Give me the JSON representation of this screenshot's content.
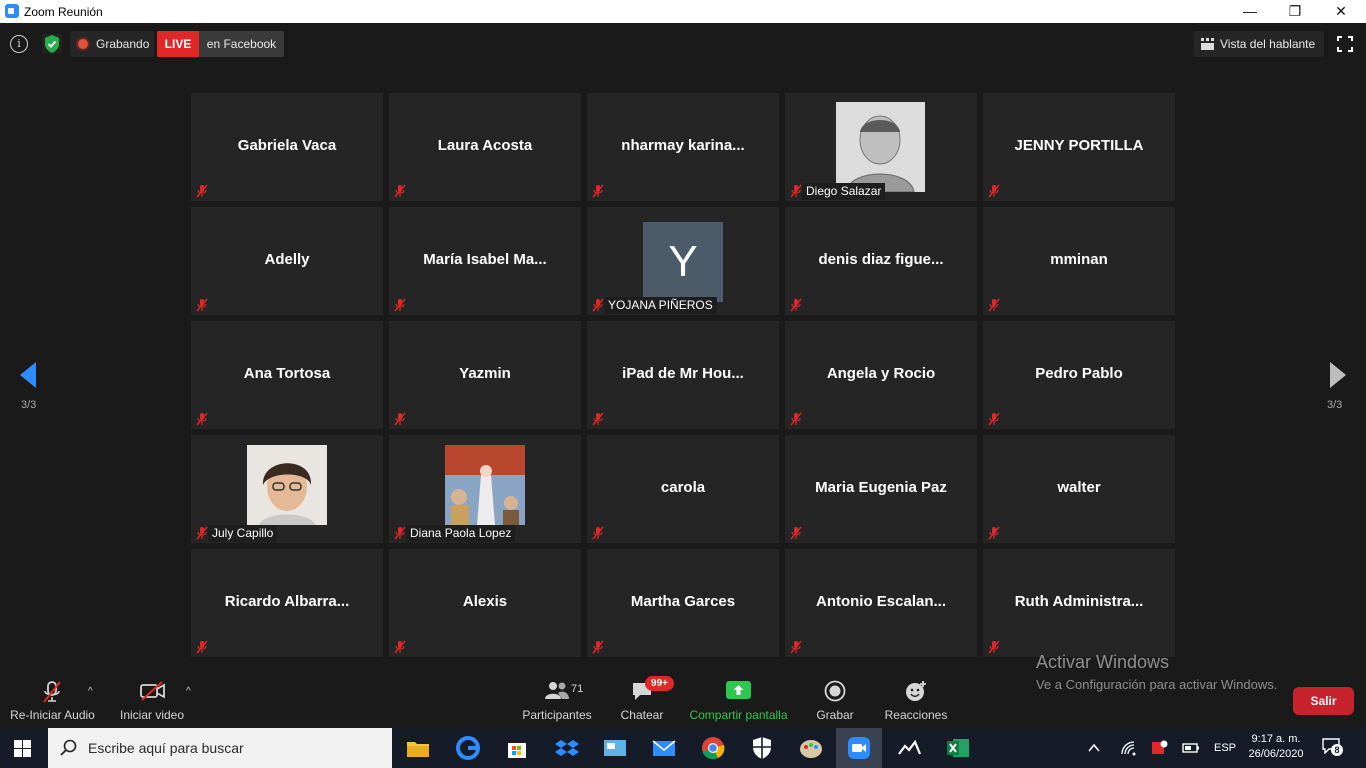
{
  "window": {
    "title": "Zoom Reunión",
    "minimize": "—",
    "maximize": "❐",
    "close": "✕"
  },
  "topbar": {
    "info_glyph": "i",
    "recording_label": "Grabando",
    "live_badge": "LIVE",
    "live_destination": "en Facebook",
    "view_button": "Vista del hablante"
  },
  "pagination": {
    "left_indicator": "3/3",
    "right_indicator": "3/3"
  },
  "participants": [
    {
      "name": "Gabriela Vaca",
      "muted": true,
      "type": "name"
    },
    {
      "name": "Laura Acosta",
      "muted": true,
      "type": "name"
    },
    {
      "name": "nharmay  karina...",
      "muted": true,
      "type": "name"
    },
    {
      "name": "Diego Salazar",
      "muted": true,
      "type": "photo"
    },
    {
      "name": "JENNY PORTILLA",
      "muted": true,
      "type": "name"
    },
    {
      "name": "Adelly",
      "muted": true,
      "type": "name"
    },
    {
      "name": "María  Isabel  Ma...",
      "muted": true,
      "type": "name"
    },
    {
      "name": "YOJANA PIÑEROS",
      "muted": true,
      "type": "avatar",
      "initial": "Y"
    },
    {
      "name": "denis  diaz  figue...",
      "muted": true,
      "type": "name"
    },
    {
      "name": "mminan",
      "muted": true,
      "type": "name"
    },
    {
      "name": "Ana Tortosa",
      "muted": true,
      "type": "name"
    },
    {
      "name": "Yazmin",
      "muted": true,
      "type": "name"
    },
    {
      "name": "iPad  de  Mr  Hou...",
      "muted": true,
      "type": "name"
    },
    {
      "name": "Angela y Rocio",
      "muted": true,
      "type": "name"
    },
    {
      "name": "Pedro Pablo",
      "muted": true,
      "type": "name"
    },
    {
      "name": "July Capillo",
      "muted": true,
      "type": "photo"
    },
    {
      "name": "Diana Paola Lopez",
      "muted": true,
      "type": "photo"
    },
    {
      "name": "carola",
      "muted": true,
      "type": "name"
    },
    {
      "name": "Maria Eugenia Paz",
      "muted": true,
      "type": "name"
    },
    {
      "name": "walter",
      "muted": true,
      "type": "name"
    },
    {
      "name": "Ricardo  Albarra...",
      "muted": true,
      "type": "name"
    },
    {
      "name": "Alexis",
      "muted": true,
      "type": "name"
    },
    {
      "name": "Martha Garces",
      "muted": true,
      "type": "name"
    },
    {
      "name": "Antonio  Escalan...",
      "muted": true,
      "type": "name"
    },
    {
      "name": "Ruth  Administra...",
      "muted": true,
      "type": "name"
    }
  ],
  "toolbar": {
    "audio_label": "Re-Iniciar Audio",
    "video_label": "Iniciar video",
    "participants_label": "Participantes",
    "participants_count": "71",
    "chat_label": "Chatear",
    "chat_badge": "99+",
    "share_label": "Compartir pantalla",
    "record_label": "Grabar",
    "reactions_label": "Reacciones",
    "leave_label": "Salir",
    "caret": "^"
  },
  "watermark": {
    "title": "Activar Windows",
    "subtitle": "Ve a Configuración para activar Windows."
  },
  "taskbar": {
    "search_placeholder": "Escribe aquí para buscar",
    "language": "ESP",
    "time": "9:17 a. m.",
    "date": "26/06/2020",
    "notification_count": "8"
  },
  "colors": {
    "live_red": "#e02828",
    "share_green": "#2dc84d",
    "leave_red": "#c6232c",
    "arrow_blue": "#2d8cff",
    "avatar_slate": "#4b5b69"
  }
}
